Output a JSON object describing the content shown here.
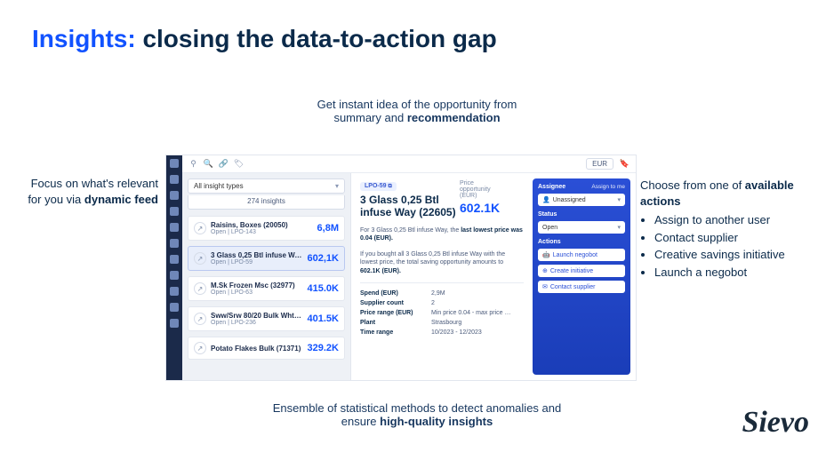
{
  "slide": {
    "title_prefix": "Insights:",
    "title_rest": " closing the data-to-action gap",
    "cap_top_a": "Get instant idea of the opportunity from",
    "cap_top_b": "summary and ",
    "cap_top_bold": "recommendation",
    "left_a": "Focus on what's relevant for you via ",
    "left_bold": "dynamic feed",
    "right_a": "Choose from one of ",
    "right_bold": "available actions",
    "right_items": [
      "Assign to another user",
      "Contact supplier",
      "Creative savings initiative",
      "Launch a negobot"
    ],
    "cap_bot_a": "Ensemble of statistical methods to detect anomalies and",
    "cap_bot_b": "ensure ",
    "cap_bot_bold": "high-quality insights",
    "brand": "Sievo"
  },
  "app": {
    "currency": "EUR",
    "filter": "All insight types",
    "count_label": "274 insights",
    "feed": [
      {
        "icon": "↗",
        "title": "Raisins, Boxes (20050)",
        "sub": "Open | LPO-143",
        "value": "6,8M"
      },
      {
        "icon": "↗",
        "title": "3 Glass 0,25 Btl infuse Way (22…",
        "sub": "Open | LPO-59",
        "value": "602,1K"
      },
      {
        "icon": "↗",
        "title": "M.Sk Frozen Msc (32977)",
        "sub": "Open | LPO-63",
        "value": "415.0K"
      },
      {
        "icon": "↗",
        "title": "Sww/Srw 80/20 Bulk Wht. (713…",
        "sub": "Open | LPO-236",
        "value": "401.5K"
      },
      {
        "icon": "↗",
        "title": "Potato Flakes Bulk (71371)",
        "sub": "",
        "value": "329.2K"
      }
    ],
    "detail": {
      "tag": "LPO-59",
      "title_a": "3 Glass 0,25 Btl",
      "title_b": "infuse Way (22605)",
      "opp_label_a": "Price",
      "opp_label_b": "opportunity",
      "opp_label_c": "(EUR)",
      "opp_value": "602.1K",
      "para1_a": "For 3 Glass 0,25 Btl infuse Way, the ",
      "para1_bold": "last lowest price was 0.04 (EUR).",
      "para2": "If you bought all 3 Glass 0,25 Btl infuse Way with the lowest price, the total saving opportunity amounts to ",
      "para2_bold": "602.1K (EUR).",
      "meta": [
        {
          "k": "Spend (EUR)",
          "v": "2,9M"
        },
        {
          "k": "Supplier count",
          "v": "2"
        },
        {
          "k": "Price range (EUR)",
          "v": "Min price 0.04 - max price …"
        },
        {
          "k": "Plant",
          "v": "Strasbourg"
        },
        {
          "k": "Time range",
          "v": "10/2023 - 12/2023"
        }
      ]
    },
    "actions": {
      "assignee_label": "Assignee",
      "assign_to_me": "Assign to me",
      "assignee_value": "Unassigned",
      "status_label": "Status",
      "status_value": "Open",
      "actions_label": "Actions",
      "buttons": [
        {
          "icon": "🤖",
          "label": "Launch negobot"
        },
        {
          "icon": "⊕",
          "label": "Create initiative"
        },
        {
          "icon": "✉",
          "label": "Contact supplier"
        }
      ]
    }
  }
}
